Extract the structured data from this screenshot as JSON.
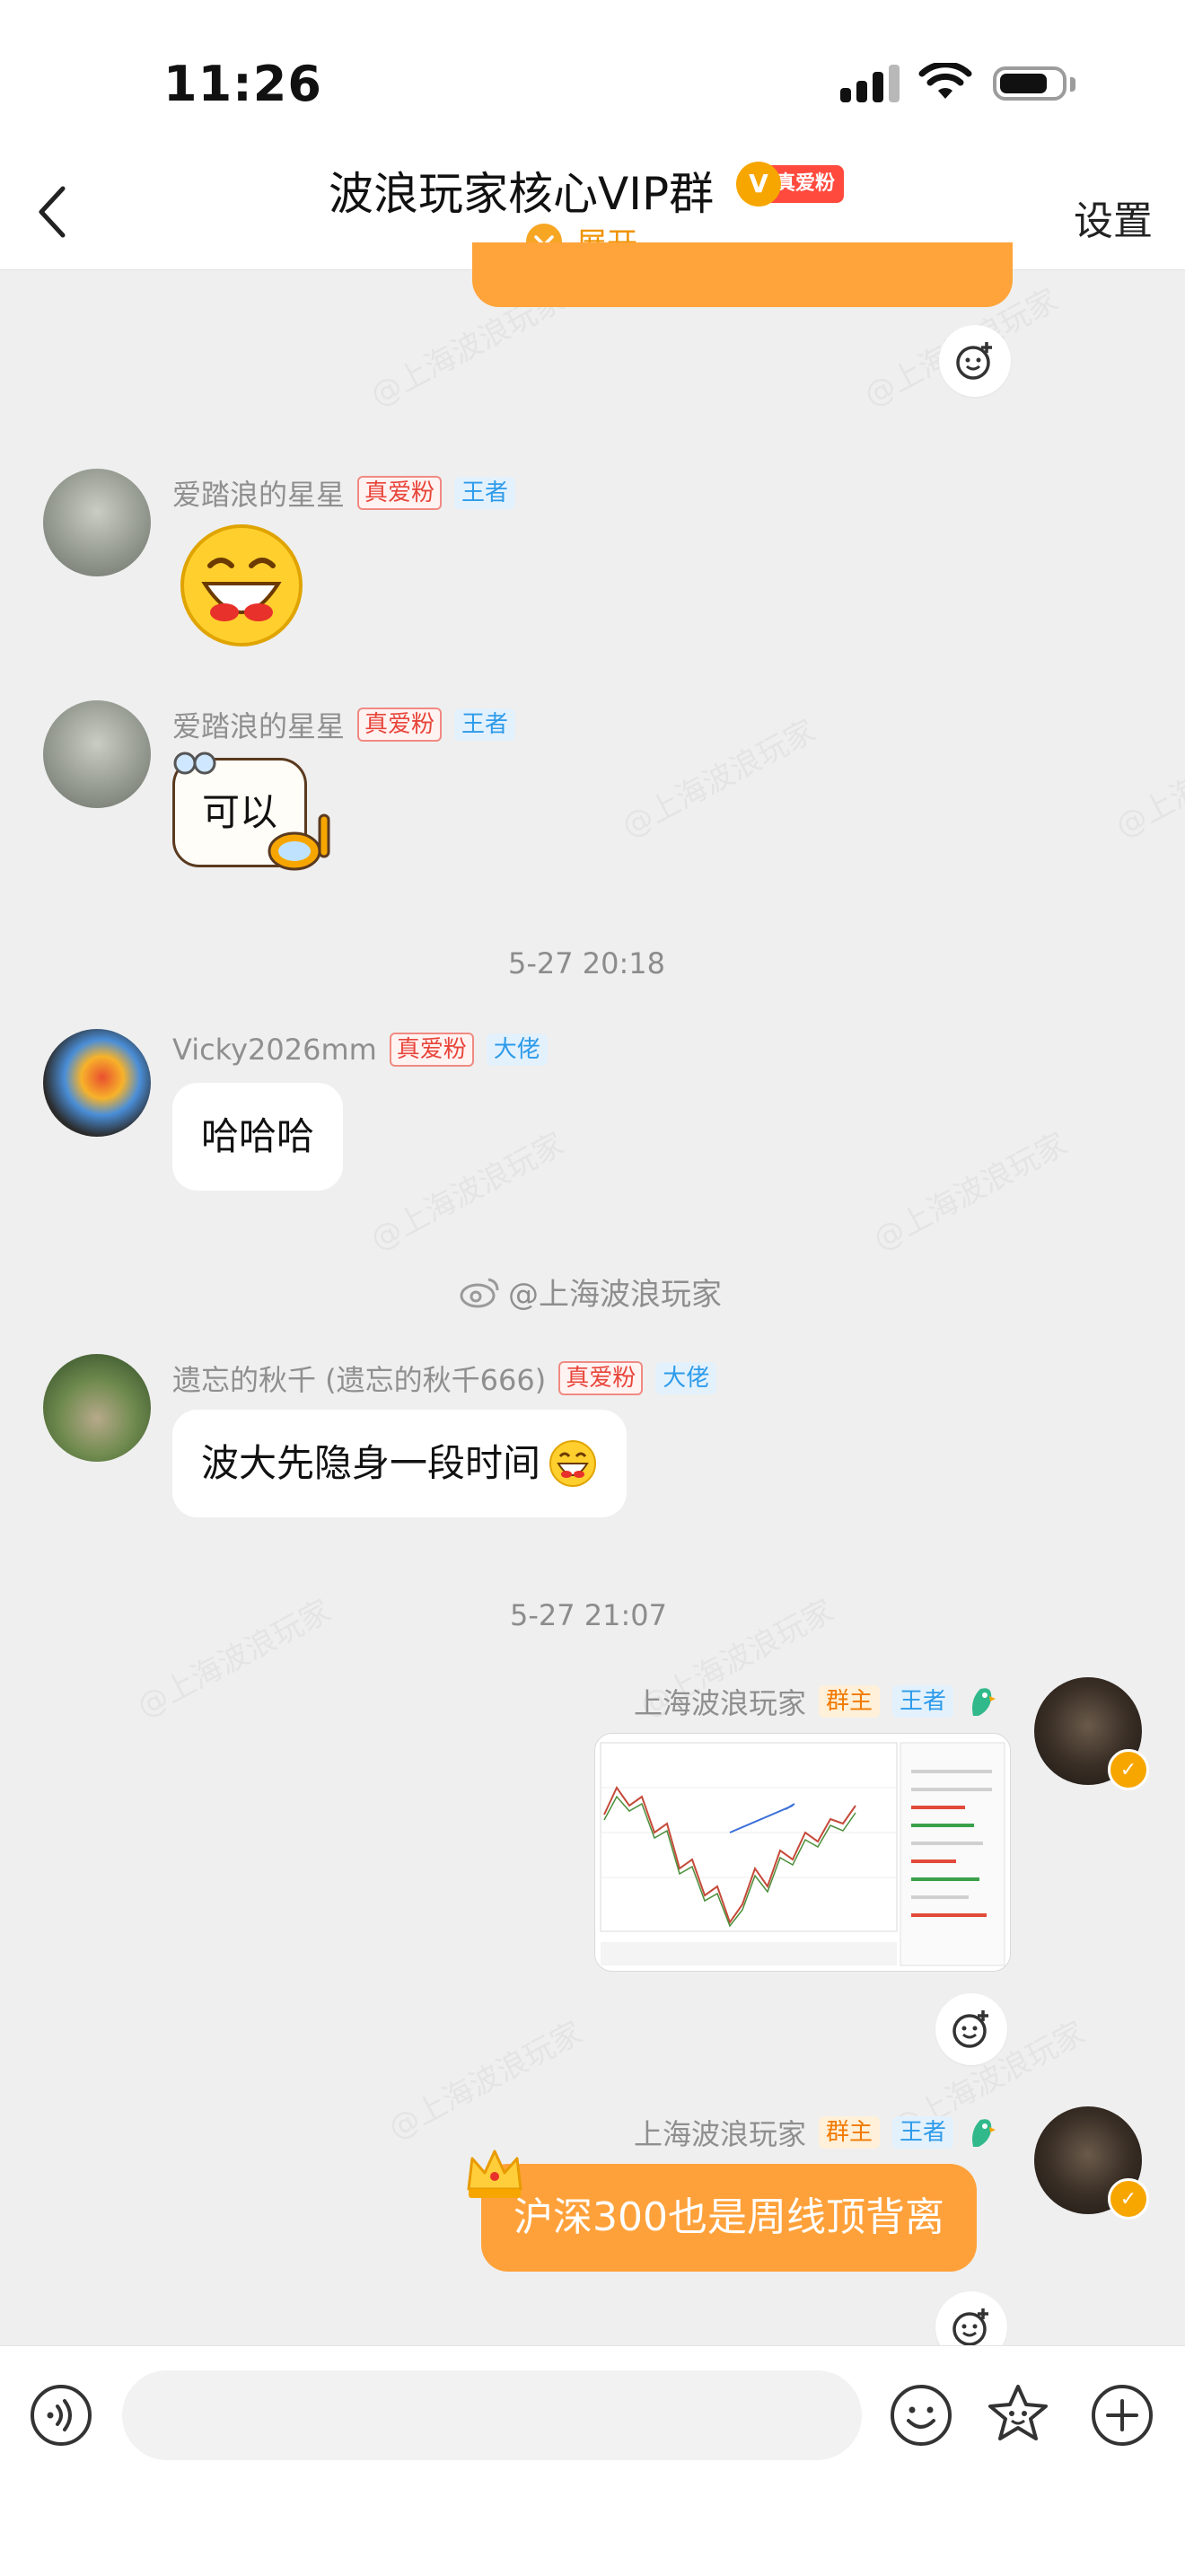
{
  "status_bar": {
    "time": "11:26"
  },
  "header": {
    "title": "波浪玩家核心VIP群",
    "badge": "真爱粉",
    "badge_v": "V",
    "expand_label": "展开",
    "settings_label": "设置"
  },
  "watermark_text": "@上海波浪玩家",
  "messages": [
    {
      "sender": "爱踏浪的星星",
      "tags": [
        "真爱粉",
        "王者"
      ],
      "content_type": "emoji",
      "emoji": "laughing-face"
    },
    {
      "sender": "爱踏浪的星星",
      "tags": [
        "真爱粉",
        "王者"
      ],
      "content_type": "text",
      "text": "可以"
    },
    {
      "timestamp": "5-27 20:18"
    },
    {
      "sender": "Vicky2026mm",
      "tags": [
        "真爱粉",
        "大佬"
      ],
      "content_type": "text",
      "text": "哈哈哈"
    },
    {
      "timestamp_overlay": "@上海波浪玩家"
    },
    {
      "sender": "遗忘的秋千 (遗忘的秋千666)",
      "tags": [
        "真爱粉",
        "大佬"
      ],
      "content_type": "text",
      "text": "波大先隐身一段时间"
    },
    {
      "timestamp": "5-27 21:07"
    },
    {
      "sender": "上海波浪玩家",
      "tags": [
        "群主",
        "王者"
      ],
      "content_type": "image",
      "image": "stock-chart-screenshot"
    },
    {
      "sender": "上海波浪玩家",
      "tags": [
        "群主",
        "王者"
      ],
      "content_type": "text",
      "text": "沪深300也是周线顶背离"
    }
  ],
  "colors": {
    "accent_orange": "#ffa13a",
    "tag_red": "#e8453a",
    "tag_blue": "#2e9bea",
    "background": "#efefef"
  },
  "icons": [
    "back-icon",
    "voice-icon",
    "emoji-icon",
    "sticker-icon",
    "plus-icon",
    "add-reaction-icon",
    "chevron-down-icon",
    "wifi-icon",
    "battery-icon",
    "signal-icon",
    "crown-icon",
    "verified-icon"
  ]
}
